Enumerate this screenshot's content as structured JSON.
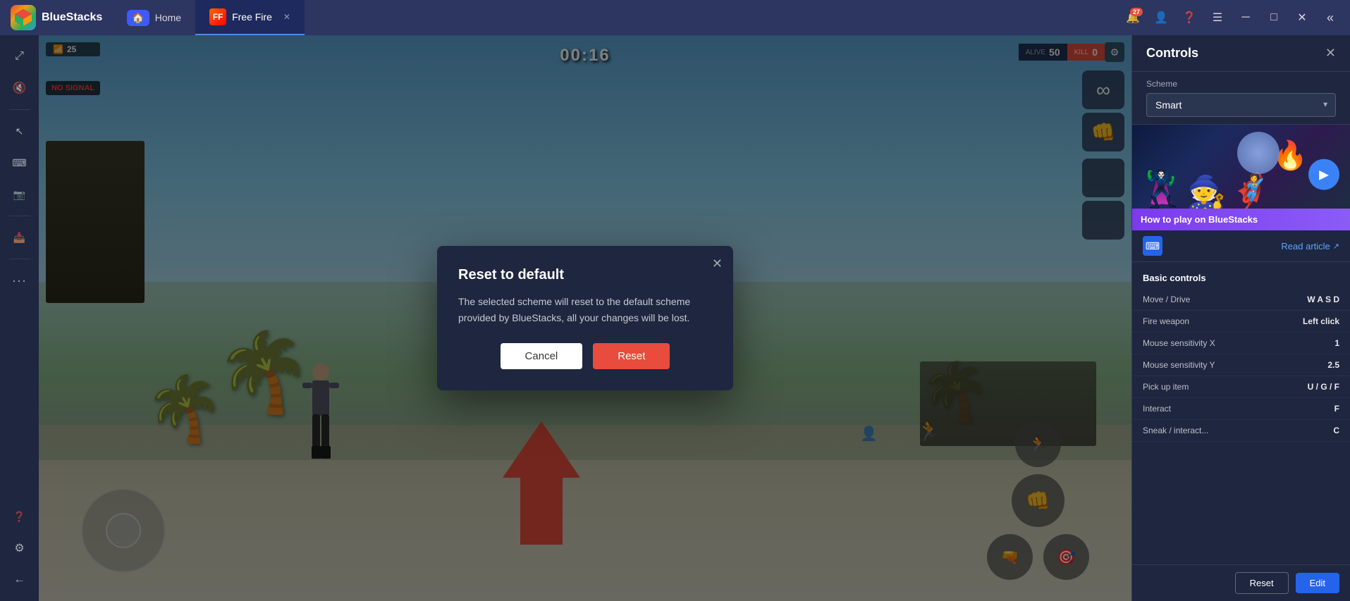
{
  "app": {
    "name": "BlueStacks",
    "logo": "🎮"
  },
  "titlebar": {
    "tabs": [
      {
        "id": "home",
        "label": "Home",
        "icon": "🏠",
        "active": false
      },
      {
        "id": "freefire",
        "label": "Free Fire",
        "active": true
      }
    ],
    "notification_count": "27",
    "buttons": [
      "notifications",
      "profile",
      "help",
      "menu",
      "minimize",
      "maximize",
      "close"
    ]
  },
  "game": {
    "timer": "00:16",
    "alive_label": "ALIVE",
    "alive_value": "50",
    "kill_label": "KILL",
    "kill_value": "0",
    "signal": "NO SIGNAL",
    "wifi_level": "25"
  },
  "modal": {
    "title": "Reset to default",
    "body": "The selected scheme will reset to the default scheme provided by BlueStacks, all your changes will be lost.",
    "cancel_label": "Cancel",
    "confirm_label": "Reset",
    "close_icon": "✕"
  },
  "controls_panel": {
    "title": "Controls",
    "close_icon": "✕",
    "scheme_label": "Scheme",
    "scheme_value": "Smart",
    "promo_title": "How to play on BlueStacks",
    "read_article_label": "Read article",
    "basic_controls_title": "Basic controls",
    "controls": [
      {
        "name": "Move / Drive",
        "key": "W A S D"
      },
      {
        "name": "Fire weapon",
        "key": "Left click"
      },
      {
        "name": "Mouse sensitivity X",
        "key": "1"
      },
      {
        "name": "Mouse sensitivity Y",
        "key": "2.5"
      },
      {
        "name": "Pick up item",
        "key": "U / G / F"
      },
      {
        "name": "Interact",
        "key": "F"
      },
      {
        "name": "Sneak / interact...",
        "key": "C"
      }
    ],
    "footer": {
      "reset_label": "Reset",
      "edit_label": "Edit"
    }
  },
  "sidebar_left": {
    "icons": [
      {
        "id": "expand",
        "symbol": "⤢",
        "label": "expand"
      },
      {
        "id": "volume",
        "symbol": "🔇",
        "label": "volume"
      },
      {
        "id": "cursor",
        "symbol": "↖",
        "label": "cursor-mode"
      },
      {
        "id": "keyboard",
        "symbol": "⌨",
        "label": "keyboard"
      },
      {
        "id": "camera",
        "symbol": "📷",
        "label": "camera"
      },
      {
        "id": "apk",
        "symbol": "⬇",
        "label": "install-apk"
      },
      {
        "id": "more",
        "symbol": "···",
        "label": "more"
      },
      {
        "id": "question",
        "symbol": "?",
        "label": "help"
      },
      {
        "id": "settings",
        "symbol": "⚙",
        "label": "settings"
      },
      {
        "id": "back",
        "symbol": "←",
        "label": "back"
      }
    ]
  }
}
